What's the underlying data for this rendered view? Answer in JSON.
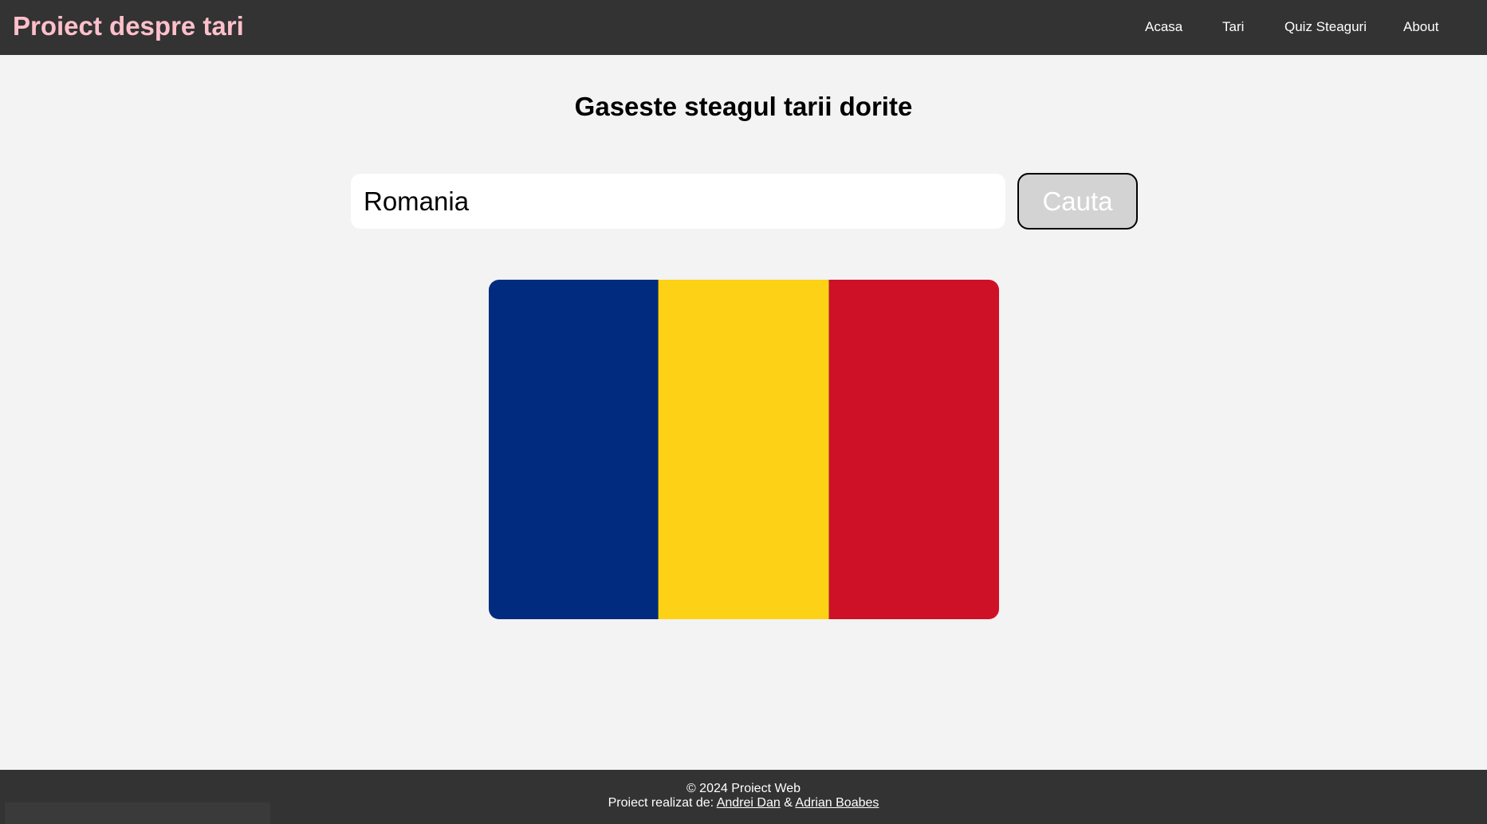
{
  "header": {
    "brand": "Proiect despre tari",
    "nav": [
      "Acasa",
      "Tari",
      "Quiz Steaguri",
      "About"
    ]
  },
  "main": {
    "title": "Gaseste steagul tarii dorite",
    "search": {
      "value": "Romania",
      "button_label": "Cauta"
    },
    "flag": {
      "country": "Romania",
      "stripes": [
        "#002b7f",
        "#fcd116",
        "#ce1126"
      ]
    }
  },
  "footer": {
    "copyright": "© 2024 Proiect Web",
    "credits_prefix": "Proiect realizat de:",
    "separator": "&",
    "authors": [
      "Andrei Dan",
      "Adrian Boabes"
    ]
  },
  "colors": {
    "brand": "#ffc0cb",
    "bar_background": "#333333",
    "page_background": "#f3f3f3",
    "button_background": "#d3d3d3"
  }
}
